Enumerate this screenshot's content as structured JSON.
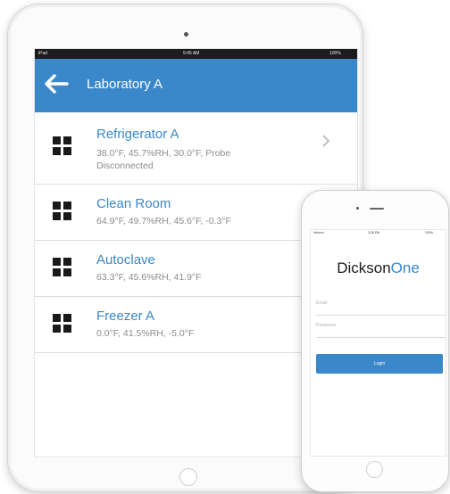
{
  "tablet": {
    "status": {
      "left": "iPad",
      "time": "9:45 AM",
      "right": "100%"
    },
    "header": {
      "title": "Laboratory A",
      "back_icon": "back-arrow-icon"
    },
    "devices": [
      {
        "name": "Refrigerator A",
        "readings": "38.0°F, 45.7%RH, 30.0°F, Probe Disconnected",
        "icon": "device-grid-icon",
        "has_chevron": true
      },
      {
        "name": "Clean Room",
        "readings": "64.9°F, 49.7%RH, 45.6°F, -0.3°F",
        "icon": "device-grid-icon"
      },
      {
        "name": "Autoclave",
        "readings": "63.3°F, 45.6%RH, 41.9°F",
        "icon": "device-grid-icon"
      },
      {
        "name": "Freezer A",
        "readings": "0.0°F, 41.5%RH, -5.0°F",
        "icon": "device-grid-icon"
      }
    ]
  },
  "phone": {
    "status": {
      "left": "Verizon",
      "time": "2:28 PM",
      "right": "100%"
    },
    "logo": {
      "part1": "Dickson",
      "part2": "One"
    },
    "email_placeholder": "Email",
    "password_placeholder": "Password",
    "login_label": "Login"
  },
  "colors": {
    "accent": "#3a87c9",
    "text_secondary": "#8c8c8c",
    "icon": "#1a1a1a"
  }
}
